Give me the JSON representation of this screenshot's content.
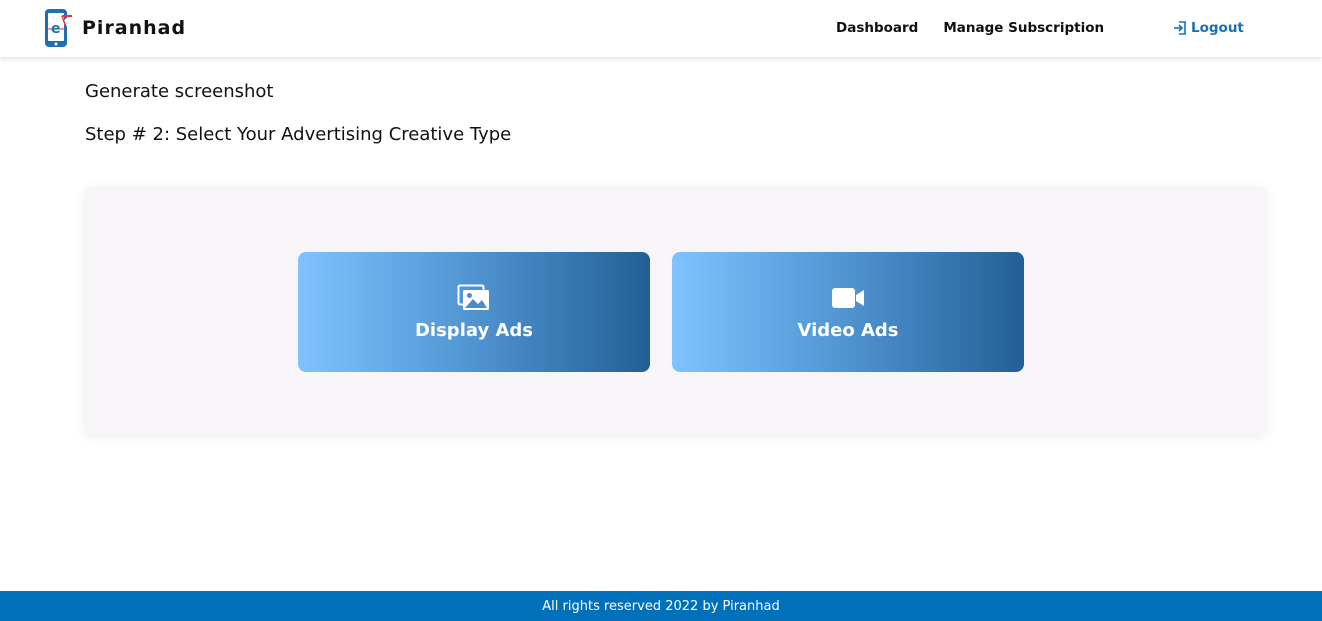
{
  "brand": {
    "name": "Piranhad",
    "logo_icon": "piranhad-phone-logo",
    "logo_text": "e"
  },
  "nav": {
    "links": [
      {
        "label": "Dashboard"
      },
      {
        "label": "Manage Subscription"
      }
    ],
    "logout": {
      "label": "Logout",
      "icon": "logout-icon"
    }
  },
  "main": {
    "page_heading": "Generate screenshot",
    "step_heading": "Step # 2: Select Your Advertising Creative Type",
    "options": [
      {
        "label": "Display Ads",
        "icon": "images-icon"
      },
      {
        "label": "Video Ads",
        "icon": "video-camera-icon"
      }
    ]
  },
  "footer": {
    "text": "All rights reserved 2022 by Piranhad"
  },
  "colors": {
    "accent": "#0070bb",
    "link": "#1a6fb5",
    "panel_bg": "#f7f5f8",
    "gradient_start": "#7fc2ff",
    "gradient_end": "#235f95"
  }
}
